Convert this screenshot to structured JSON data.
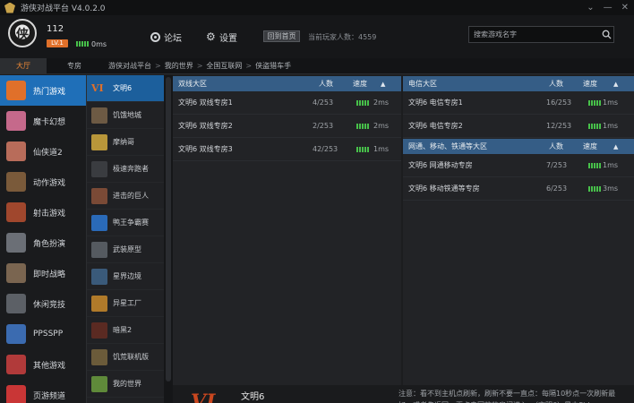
{
  "window": {
    "title": "游侠对战平台 V4.0.2.0",
    "controls": [
      "⌄",
      "—",
      "✕"
    ]
  },
  "user": {
    "id": "112",
    "level": "LV.1",
    "ping": "0ms"
  },
  "header": {
    "forum_label": "论坛",
    "settings_label": "设置",
    "home_label": "回到首页",
    "online_text": "当前玩家人数：4559",
    "search_placeholder": "搜索游戏名字"
  },
  "tabs": {
    "hall": "大厅",
    "rooms": "专房"
  },
  "breadcrumb": [
    "游侠对战平台",
    "我的世界",
    "全国互联网",
    "侠盗猎车手"
  ],
  "categories": [
    {
      "label": "热门游戏",
      "icon": "hot-icon",
      "color": "#e0702a"
    },
    {
      "label": "魔卡幻想",
      "icon": "magic-card-icon",
      "color": "#c5698b"
    },
    {
      "label": "仙侠道2",
      "icon": "xianxia-icon",
      "color": "#b86c5a"
    },
    {
      "label": "动作游戏",
      "icon": "action-icon",
      "color": "#7a5a3a"
    },
    {
      "label": "射击游戏",
      "icon": "shooter-icon",
      "color": "#a0472d"
    },
    {
      "label": "角色扮演",
      "icon": "rpg-icon",
      "color": "#6b6f76"
    },
    {
      "label": "即时战略",
      "icon": "rts-icon",
      "color": "#7a6550"
    },
    {
      "label": "休闲竞技",
      "icon": "casual-icon",
      "color": "#5c6066"
    },
    {
      "label": "PPSSPP",
      "icon": "ppsspp-icon",
      "color": "#3b6bb0"
    },
    {
      "label": "其他游戏",
      "icon": "other-games-icon",
      "color": "#b13a3a"
    },
    {
      "label": "页游频道",
      "icon": "webgame-icon",
      "color": "#c93636"
    }
  ],
  "games": [
    {
      "label": "文明6",
      "icon": "civ6-icon",
      "color": "#e0702a"
    },
    {
      "label": "饥饿地城",
      "icon": "hunger-dungeon-icon",
      "color": "#6d5a44"
    },
    {
      "label": "摩纳哥",
      "icon": "monaco-icon",
      "color": "#b8963a"
    },
    {
      "label": "极速奔跑者",
      "icon": "speedrunners-icon",
      "color": "#3a3c40"
    },
    {
      "label": "进击的巨人",
      "icon": "titan-icon",
      "color": "#7a4a36"
    },
    {
      "label": "鸭王争霸赛",
      "icon": "duck-game-icon",
      "color": "#2a6ab8"
    },
    {
      "label": "武装原型",
      "icon": "prototype-icon",
      "color": "#555a60"
    },
    {
      "label": "星界边境",
      "icon": "starbound-icon",
      "color": "#3a5a7a"
    },
    {
      "label": "异星工厂",
      "icon": "factorio-icon",
      "color": "#b07a2a"
    },
    {
      "label": "暗黑2",
      "icon": "diablo2-icon",
      "color": "#5a2a22"
    },
    {
      "label": "饥荒联机版",
      "icon": "dont-starve-icon",
      "color": "#6b5b3a"
    },
    {
      "label": "我的世界",
      "icon": "minecraft-icon",
      "color": "#5f8a3a"
    }
  ],
  "panels": {
    "dual": {
      "title": "双线大区",
      "count_header": "人数",
      "speed_header": "速度",
      "rooms": [
        {
          "name": "文明6 双线专房1",
          "count": "4/253",
          "ping": "2ms"
        },
        {
          "name": "文明6 双线专房2",
          "count": "2/253",
          "ping": "2ms"
        },
        {
          "name": "文明6 双线专房3",
          "count": "42/253",
          "ping": "1ms"
        }
      ]
    },
    "telecom": {
      "title": "电信大区",
      "count_header": "人数",
      "speed_header": "速度",
      "rooms": [
        {
          "name": "文明6 电信专房1",
          "count": "16/253",
          "ping": "1ms"
        },
        {
          "name": "文明6 电信专房2",
          "count": "12/253",
          "ping": "1ms"
        }
      ]
    },
    "netcom": {
      "title": "网通、移动、铁通等大区",
      "count_header": "人数",
      "speed_header": "速度",
      "rooms": [
        {
          "name": "文明6 网通移动专房",
          "count": "7/253",
          "ping": "1ms"
        },
        {
          "name": "文明6 移动铁通等专房",
          "count": "6/253",
          "ping": "3ms"
        }
      ]
    }
  },
  "footer": {
    "logo": "VI",
    "game": "文明6",
    "notice": "注意：看不到主机点刷新，刷新不要一直点：每隔10秒点一次刷新最好，或者先返回，再点击回放的房间进入。（文明6）是由Sid..."
  }
}
